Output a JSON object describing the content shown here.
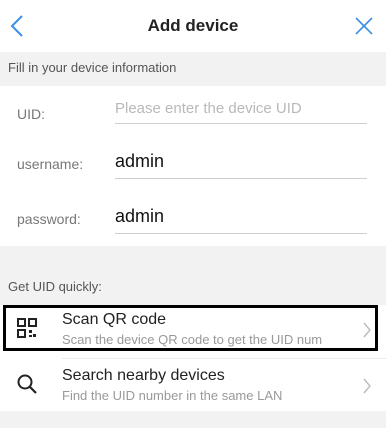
{
  "header": {
    "title": "Add device",
    "back_icon": "chevron-left-icon",
    "close_icon": "close-icon",
    "accent_color": "#3a8fe8"
  },
  "form": {
    "section_label": "Fill in your device information",
    "uid": {
      "label": "UID:",
      "placeholder": "Please enter the device UID",
      "value": ""
    },
    "username": {
      "label": "username:",
      "value": "admin"
    },
    "password": {
      "label": "password:",
      "value": "admin"
    }
  },
  "quick": {
    "section_label": "Get UID quickly:",
    "items": [
      {
        "icon": "qr-code-icon",
        "title": "Scan QR code",
        "subtitle": "Scan the device QR code to get the UID num"
      },
      {
        "icon": "search-icon",
        "title": "Search nearby devices",
        "subtitle": "Find the UID number in the same LAN"
      }
    ]
  }
}
